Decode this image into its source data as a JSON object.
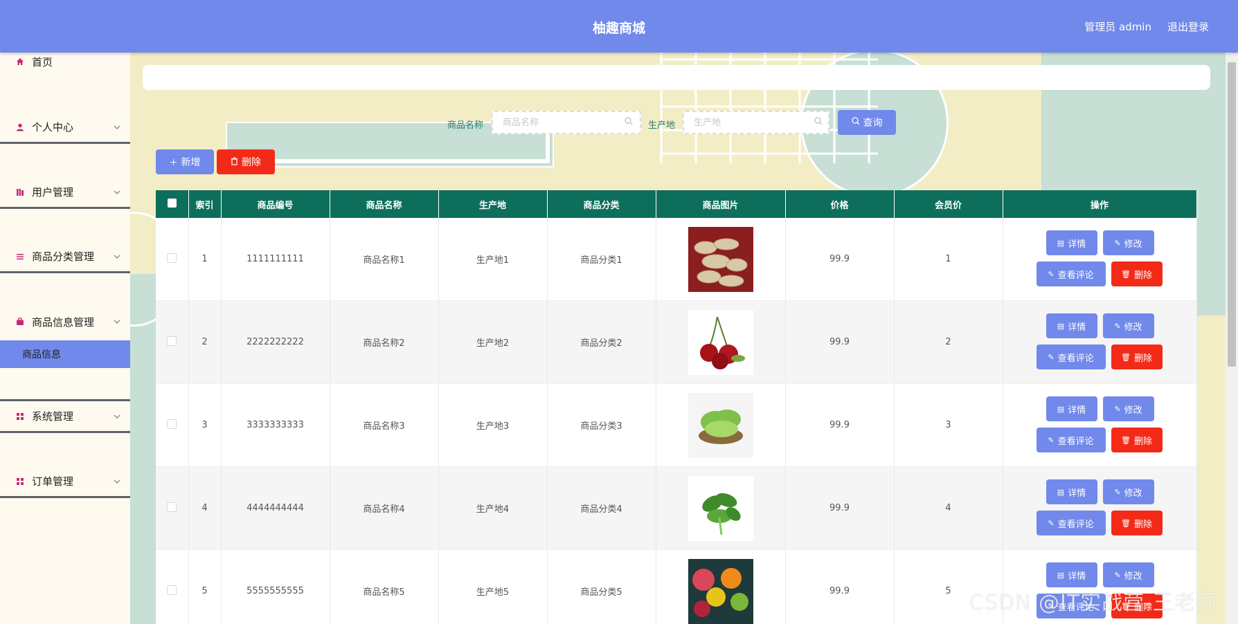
{
  "header": {
    "title": "柚趣商城",
    "admin_label": "管理员 admin",
    "logout_label": "退出登录"
  },
  "sidebar": {
    "items": [
      {
        "label": "首页",
        "icon": "home-icon"
      },
      {
        "label": "个人中心",
        "icon": "user-icon"
      },
      {
        "label": "用户管理",
        "icon": "books-icon"
      },
      {
        "label": "商品分类管理",
        "icon": "list-icon"
      },
      {
        "label": "商品信息管理",
        "icon": "briefcase-icon"
      },
      {
        "label": "系统管理",
        "icon": "grid-icon"
      },
      {
        "label": "订单管理",
        "icon": "grid-icon"
      }
    ],
    "active_sub": "商品信息"
  },
  "search": {
    "name_label": "商品名称",
    "name_placeholder": "商品名称",
    "origin_label": "生产地",
    "origin_placeholder": "生产地",
    "query_label": "查询"
  },
  "toolbar": {
    "add_label": "新增",
    "delete_label": "删除"
  },
  "table": {
    "columns": [
      "索引",
      "商品编号",
      "商品名称",
      "生产地",
      "商品分类",
      "商品图片",
      "价格",
      "会员价",
      "操作"
    ],
    "rows": [
      {
        "index": "1",
        "code": "1111111111",
        "name": "商品名称1",
        "origin": "生产地1",
        "category": "商品分类1",
        "price": "99.9",
        "member_price": "1",
        "image": "ginger"
      },
      {
        "index": "2",
        "code": "2222222222",
        "name": "商品名称2",
        "origin": "生产地2",
        "category": "商品分类2",
        "price": "99.9",
        "member_price": "2",
        "image": "cherries"
      },
      {
        "index": "3",
        "code": "3333333333",
        "name": "商品名称3",
        "origin": "生产地3",
        "category": "商品分类3",
        "price": "99.9",
        "member_price": "3",
        "image": "lettuce"
      },
      {
        "index": "4",
        "code": "4444444444",
        "name": "商品名称4",
        "origin": "生产地4",
        "category": "商品分类4",
        "price": "99.9",
        "member_price": "4",
        "image": "spinach"
      },
      {
        "index": "5",
        "code": "5555555555",
        "name": "商品名称5",
        "origin": "生产地5",
        "category": "商品分类5",
        "price": "99.9",
        "member_price": "5",
        "image": "fruits"
      }
    ],
    "actions": {
      "detail": "详情",
      "edit": "修改",
      "comments": "查看评论",
      "delete": "删除"
    }
  },
  "watermark": "CSDN @IT实战营-王老师",
  "colors": {
    "header": "#7089ea",
    "table_header": "#0e6e5c",
    "danger": "#f42a18",
    "sidebar_bg": "#fffaef"
  }
}
